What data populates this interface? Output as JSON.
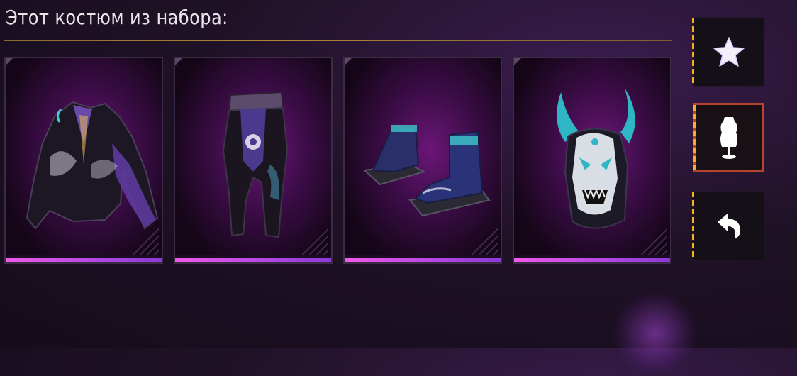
{
  "header": {
    "title": "Этот костюм из набора:"
  },
  "set_items": [
    {
      "name": "jacket"
    },
    {
      "name": "pants"
    },
    {
      "name": "sandals"
    },
    {
      "name": "oni-mask"
    }
  ],
  "side_buttons": [
    {
      "icon": "star-icon",
      "active": false
    },
    {
      "icon": "mannequin-icon",
      "active": true
    },
    {
      "icon": "back-arrow-icon",
      "active": false
    }
  ],
  "colors": {
    "accent_gold": "#c89a3a",
    "rarity_bar": "#f05ae8",
    "active_border": "#b5452f",
    "dash_yellow": "#f5b21e"
  }
}
